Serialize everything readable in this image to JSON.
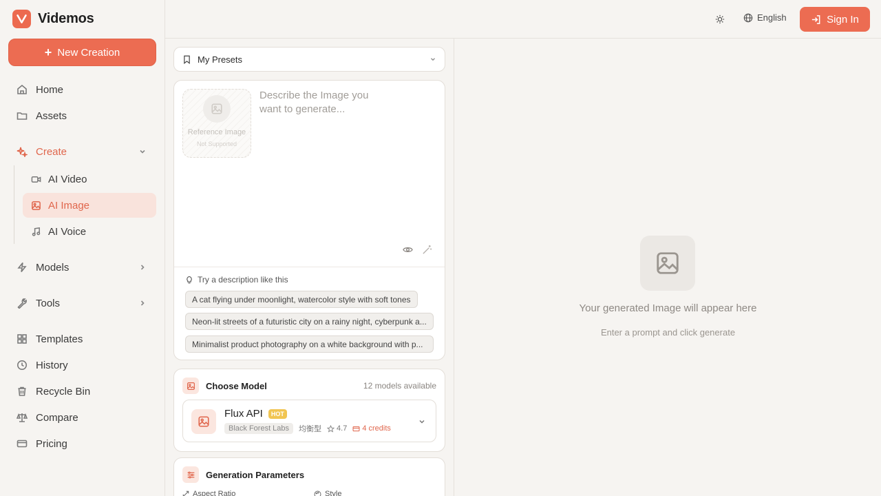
{
  "brand": {
    "name": "Videmos"
  },
  "sidebar": {
    "new_creation": "New Creation",
    "items": [
      {
        "label": "Home"
      },
      {
        "label": "Assets"
      },
      {
        "label": "Create"
      },
      {
        "label": "Models"
      },
      {
        "label": "Tools"
      },
      {
        "label": "Templates"
      },
      {
        "label": "History"
      },
      {
        "label": "Recycle Bin"
      },
      {
        "label": "Compare"
      },
      {
        "label": "Pricing"
      }
    ],
    "create_sub": [
      {
        "label": "AI Video"
      },
      {
        "label": "AI Image",
        "active": true
      },
      {
        "label": "AI Voice"
      }
    ]
  },
  "topbar": {
    "language": "English",
    "sign_in": "Sign In"
  },
  "presets": {
    "label": "My Presets"
  },
  "prompt": {
    "placeholder": "Describe the Image you want to generate...",
    "reference_label": "Reference Image",
    "reference_sub": "Not Supported"
  },
  "suggestions": {
    "title": "Try a description like this",
    "items": [
      "A cat flying under moonlight, watercolor style with soft tones",
      "Neon-lit streets of a futuristic city on a rainy night, cyberpunk a...",
      "Minimalist product photography on a white background with p..."
    ]
  },
  "model": {
    "section_title": "Choose Model",
    "count": "12 models available",
    "name": "Flux API",
    "badge": "HOT",
    "provider": "Black Forest Labs",
    "type": "均衡型",
    "rating": "4.7",
    "credits": "4 credits"
  },
  "params": {
    "section_title": "Generation Parameters",
    "aspect_ratio": "Aspect Ratio",
    "style": "Style"
  },
  "preview": {
    "title": "Your generated Image will appear here",
    "subtitle": "Enter a prompt and click generate"
  },
  "colors": {
    "accent": "#ec6c52",
    "accent_soft": "#f9e3dc",
    "background": "#f6f4f1"
  }
}
